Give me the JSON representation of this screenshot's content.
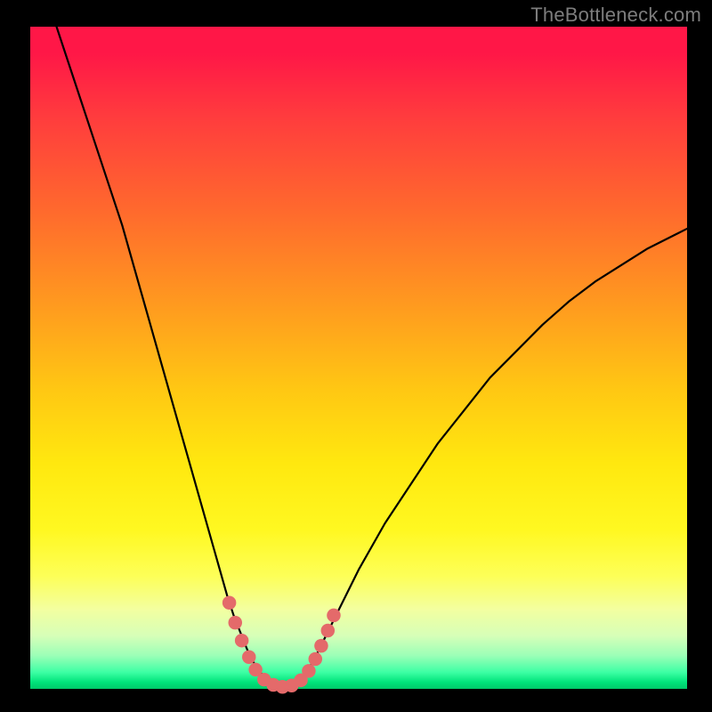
{
  "watermark": "TheBottleneck.com",
  "colors": {
    "curve": "#000000",
    "marker": "#e46a6a",
    "gradient_top": "#ff1747",
    "gradient_bottom": "#00c869",
    "frame": "#000000"
  },
  "chart_data": {
    "type": "line",
    "title": "",
    "xlabel": "",
    "ylabel": "",
    "xlim": [
      0,
      100
    ],
    "ylim": [
      0,
      100
    ],
    "grid": false,
    "legend": false,
    "note": "V-curve descending steeply from top-left, reaching ~0 around x≈35–41, then rising with decreasing slope toward upper-right. y values are % of plot height from bottom; x values are % of plot width from left.",
    "series": [
      {
        "name": "curve",
        "x": [
          4,
          6,
          8,
          10,
          12,
          14,
          16,
          18,
          20,
          22,
          24,
          26,
          28,
          30,
          31,
          32,
          33,
          34,
          35,
          36,
          37,
          38,
          39,
          40,
          41,
          42,
          43,
          44,
          46,
          48,
          50,
          54,
          58,
          62,
          66,
          70,
          74,
          78,
          82,
          86,
          90,
          94,
          98,
          100
        ],
        "y": [
          100,
          94,
          88,
          82,
          76,
          70,
          63,
          56,
          49,
          42,
          35,
          28,
          21,
          14,
          11,
          8.5,
          6,
          4,
          2.5,
          1.4,
          0.7,
          0.3,
          0.3,
          0.7,
          1.4,
          2.5,
          4,
          6,
          10,
          14,
          18,
          25,
          31,
          37,
          42,
          47,
          51,
          55,
          58.5,
          61.5,
          64,
          66.5,
          68.5,
          69.5
        ]
      }
    ],
    "markers": {
      "name": "highlight-dots",
      "color": "#e46a6a",
      "radius_percent": 1.05,
      "points_xy": [
        [
          30.3,
          13.0
        ],
        [
          31.2,
          10.0
        ],
        [
          32.2,
          7.3
        ],
        [
          33.3,
          4.8
        ],
        [
          34.3,
          2.9
        ],
        [
          35.6,
          1.4
        ],
        [
          37.0,
          0.6
        ],
        [
          38.4,
          0.3
        ],
        [
          39.8,
          0.5
        ],
        [
          41.2,
          1.3
        ],
        [
          42.4,
          2.7
        ],
        [
          43.4,
          4.5
        ],
        [
          44.3,
          6.5
        ],
        [
          45.3,
          8.8
        ],
        [
          46.2,
          11.1
        ]
      ]
    }
  }
}
